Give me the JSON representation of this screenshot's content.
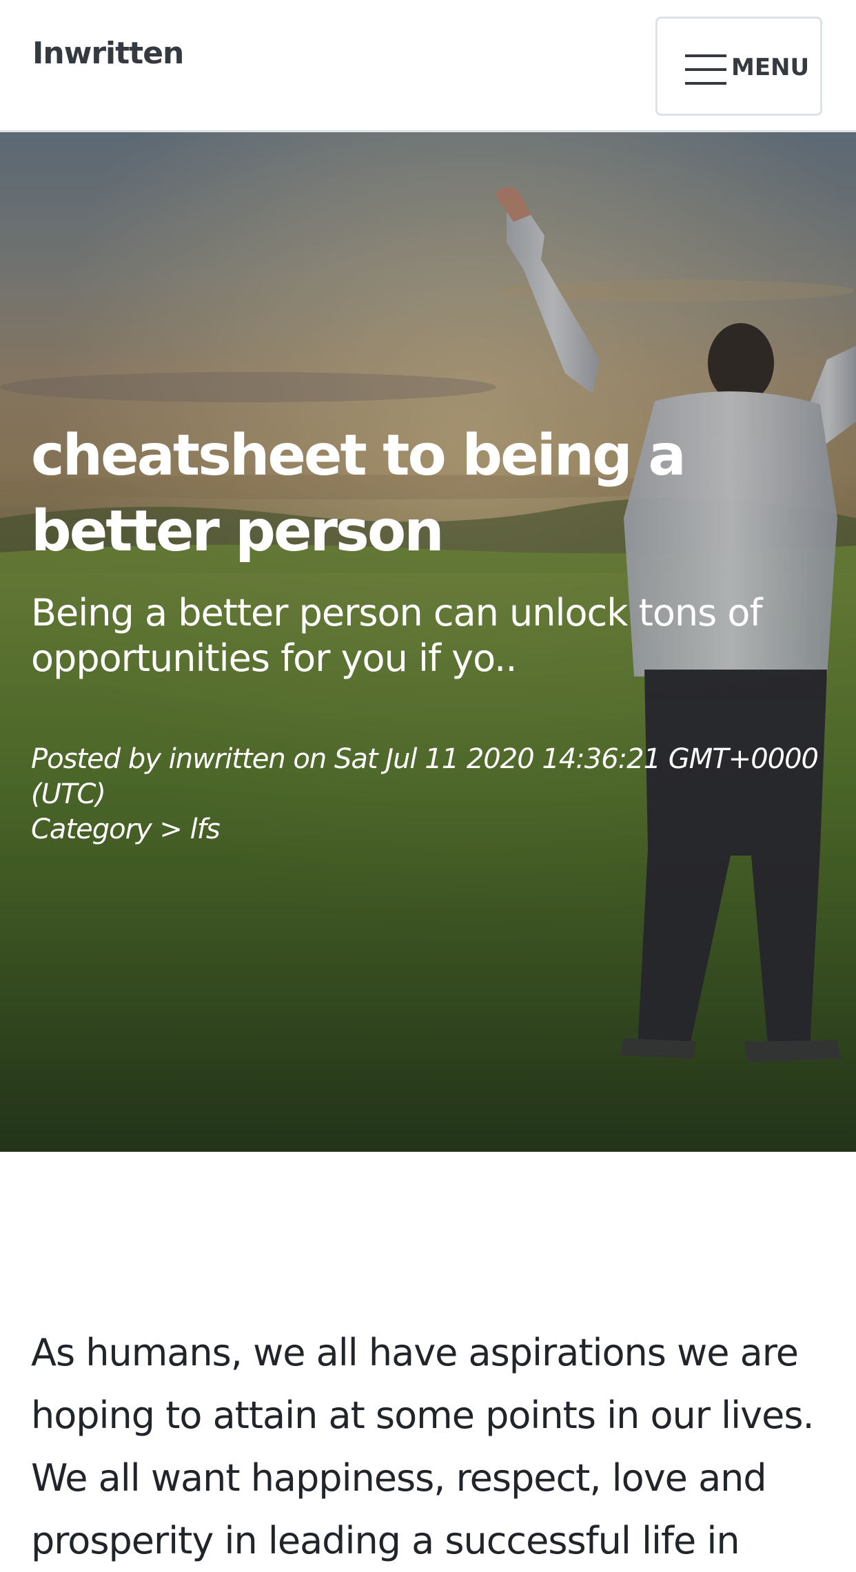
{
  "navbar": {
    "brand": "Inwritten",
    "menu_label": "MENU"
  },
  "hero": {
    "title": "cheatsheet to being a better person",
    "subtitle": "Being a better person can unlock tons of opportunities for you if yo..",
    "meta": {
      "posted_by_prefix": "Posted by",
      "author": "inwritten",
      "on_text": "on",
      "date": "Sat Jul 11 2020 14:36:21 GMT+0000 (UTC)",
      "category_prefix": "Category >",
      "category": "lfs"
    }
  },
  "article": {
    "paragraph": "As humans, we all have aspirations we are hoping to attain at some points in our lives. We all want happiness, respect, love and prosperity in leading a successful life in"
  },
  "colors": {
    "nav_text": "#343a40",
    "body_text": "#212529",
    "hero_text": "#ffffff"
  }
}
